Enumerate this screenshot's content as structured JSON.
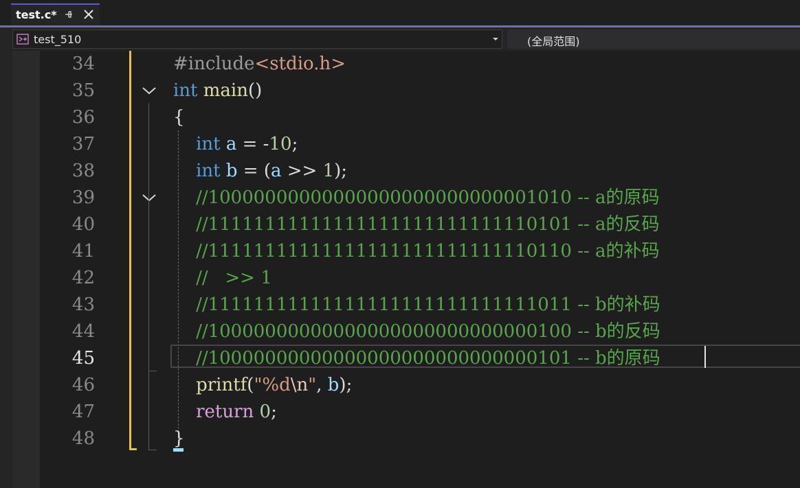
{
  "tab": {
    "title": "test.c*"
  },
  "nav": {
    "project": "test_510",
    "scope": "(全局范围)"
  },
  "editor": {
    "current_line": 45,
    "lines": [
      {
        "n": "34",
        "tokens": [
          {
            "t": "#include",
            "c": "pp"
          },
          {
            "t": "<stdio.h>",
            "c": "str"
          }
        ]
      },
      {
        "n": "35",
        "tokens": [
          {
            "t": "int",
            "c": "kw"
          },
          {
            "t": " ",
            "c": ""
          },
          {
            "t": "main",
            "c": "fn"
          },
          {
            "t": "()",
            "c": ""
          }
        ]
      },
      {
        "n": "36",
        "tokens": [
          {
            "t": "{",
            "c": ""
          }
        ]
      },
      {
        "n": "37",
        "tokens": [
          {
            "t": "    ",
            "c": ""
          },
          {
            "t": "int",
            "c": "kw"
          },
          {
            "t": " ",
            "c": ""
          },
          {
            "t": "a",
            "c": "var"
          },
          {
            "t": " = -",
            "c": ""
          },
          {
            "t": "10",
            "c": "num"
          },
          {
            "t": ";",
            "c": ""
          }
        ]
      },
      {
        "n": "38",
        "tokens": [
          {
            "t": "    ",
            "c": ""
          },
          {
            "t": "int",
            "c": "kw"
          },
          {
            "t": " ",
            "c": ""
          },
          {
            "t": "b",
            "c": "var"
          },
          {
            "t": " = (",
            "c": ""
          },
          {
            "t": "a",
            "c": "var"
          },
          {
            "t": " >> ",
            "c": ""
          },
          {
            "t": "1",
            "c": "num"
          },
          {
            "t": ");",
            "c": ""
          }
        ]
      },
      {
        "n": "39",
        "tokens": [
          {
            "t": "    ",
            "c": ""
          },
          {
            "t": "//10000000000000000000000000001010 -- a的原码",
            "c": "cmt"
          }
        ]
      },
      {
        "n": "40",
        "tokens": [
          {
            "t": "    ",
            "c": ""
          },
          {
            "t": "//11111111111111111111111111110101 -- a的反码",
            "c": "cmt"
          }
        ]
      },
      {
        "n": "41",
        "tokens": [
          {
            "t": "    ",
            "c": ""
          },
          {
            "t": "//11111111111111111111111111110110 -- a的补码",
            "c": "cmt"
          }
        ]
      },
      {
        "n": "42",
        "tokens": [
          {
            "t": "    ",
            "c": ""
          },
          {
            "t": "//   >> 1",
            "c": "cmt"
          }
        ]
      },
      {
        "n": "43",
        "tokens": [
          {
            "t": "    ",
            "c": ""
          },
          {
            "t": "//11111111111111111111111111111011 -- b的补码",
            "c": "cmt"
          }
        ]
      },
      {
        "n": "44",
        "tokens": [
          {
            "t": "    ",
            "c": ""
          },
          {
            "t": "//10000000000000000000000000000100 -- b的反码",
            "c": "cmt"
          }
        ]
      },
      {
        "n": "45",
        "tokens": [
          {
            "t": "    ",
            "c": ""
          },
          {
            "t": "//10000000000000000000000000000101 -- b的原码",
            "c": "cmt"
          }
        ]
      },
      {
        "n": "46",
        "tokens": [
          {
            "t": "    ",
            "c": ""
          },
          {
            "t": "printf",
            "c": "fn"
          },
          {
            "t": "(",
            "c": ""
          },
          {
            "t": "\"%d",
            "c": "str"
          },
          {
            "t": "\\n",
            "c": "esc"
          },
          {
            "t": "\"",
            "c": "str"
          },
          {
            "t": ", ",
            "c": ""
          },
          {
            "t": "b",
            "c": "var"
          },
          {
            "t": ");",
            "c": ""
          }
        ]
      },
      {
        "n": "47",
        "tokens": [
          {
            "t": "    ",
            "c": ""
          },
          {
            "t": "return",
            "c": "ctl"
          },
          {
            "t": " ",
            "c": ""
          },
          {
            "t": "0",
            "c": "num"
          },
          {
            "t": ";",
            "c": ""
          }
        ]
      },
      {
        "n": "48",
        "tokens": [
          {
            "t": "}",
            "c": ""
          }
        ]
      }
    ]
  },
  "colors": {
    "keyword": "#569cd6",
    "function": "#dcdcaa",
    "variable": "#9cdcfe",
    "number": "#b5cea8",
    "string": "#d69d85",
    "comment": "#57a64a",
    "preprocessor": "#9b9b9b",
    "control": "#d8a0df",
    "change_bar": "#e8c33a",
    "accent": "#6c69c9"
  },
  "icons": {
    "tab_pin": "pin-icon",
    "tab_close": "close-icon",
    "project": "project-icon",
    "dropdown": "chevron-down-icon",
    "fold": "fold-chevron-icon"
  }
}
